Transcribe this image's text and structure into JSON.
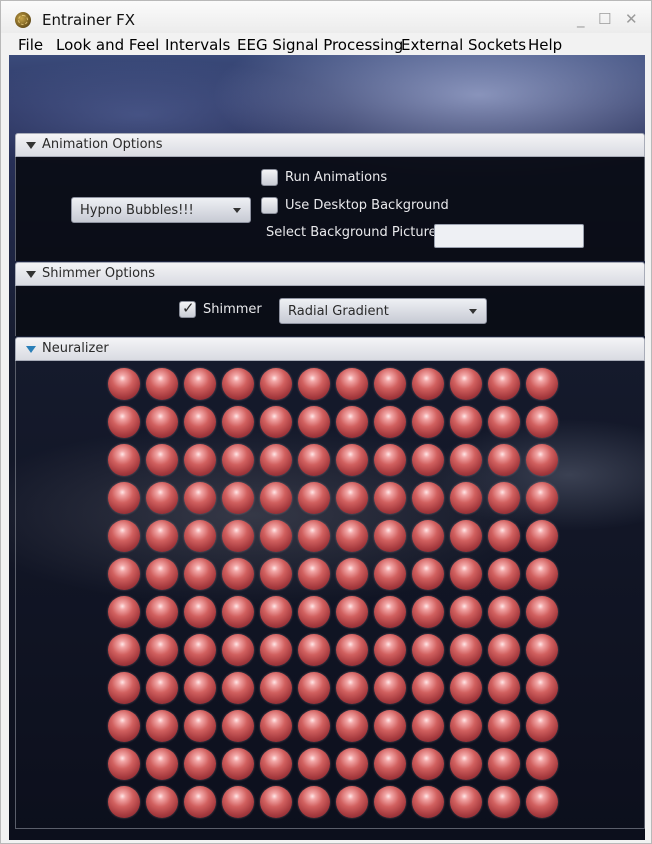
{
  "window": {
    "title": "Entrainer FX",
    "controls": {
      "minimize": "_",
      "maximize": "☐",
      "close": "✕"
    }
  },
  "menubar": {
    "items": [
      {
        "label": "File"
      },
      {
        "label": "Look and Feel"
      },
      {
        "label": "Intervals"
      },
      {
        "label": "EEG Signal Processing"
      },
      {
        "label": "External Sockets"
      },
      {
        "label": "Help"
      }
    ]
  },
  "animation_options": {
    "title": "Animation Options",
    "animation_select": "Hypno Bubbles!!!",
    "run_animations": {
      "label": "Run Animations",
      "checked": false
    },
    "use_desktop_background": {
      "label": "Use Desktop Background",
      "checked": false
    },
    "background_picture": {
      "label": "Select Background Picture",
      "value": ""
    }
  },
  "shimmer_options": {
    "title": "Shimmer Options",
    "shimmer": {
      "label": "Shimmer",
      "checked": true,
      "mark": "✓"
    },
    "shimmer_type": "Radial Gradient"
  },
  "neuralizer": {
    "title": "Neuralizer",
    "rows": 12,
    "cols": 12
  },
  "colors": {
    "accent_blue": "#2a7fb8",
    "bubble": "#c24f52",
    "panel_dark": "#0a0c14"
  }
}
